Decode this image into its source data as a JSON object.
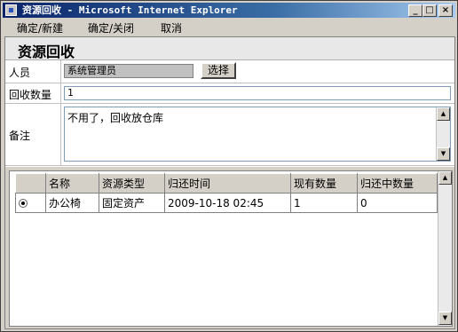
{
  "window": {
    "title": "资源回收 - Microsoft Internet Explorer"
  },
  "titlebar_buttons": {
    "minimize": "_",
    "maximize": "□",
    "close": "×"
  },
  "menu": [
    {
      "label": "确定/新建"
    },
    {
      "label": "确定/关闭"
    },
    {
      "label": "取消"
    }
  ],
  "page": {
    "title": "资源回收"
  },
  "form": {
    "person": {
      "label": "人员",
      "value": "系统管理员",
      "select_button": "选择"
    },
    "quantity": {
      "label": "回收数量",
      "value": "1"
    },
    "note": {
      "label": "备注",
      "value": "不用了，回收放仓库"
    }
  },
  "grid": {
    "columns": [
      "",
      "名称",
      "资源类型",
      "归还时间",
      "现有数量",
      "归还中数量"
    ],
    "rows": [
      {
        "selected": true,
        "name": "办公椅",
        "type": "固定资产",
        "return_time": "2009-10-18 02:45",
        "current_qty": "1",
        "returning_qty": "0"
      }
    ]
  },
  "icons": {
    "scroll_up": "up-arrow-icon",
    "scroll_down": "down-arrow-icon"
  }
}
